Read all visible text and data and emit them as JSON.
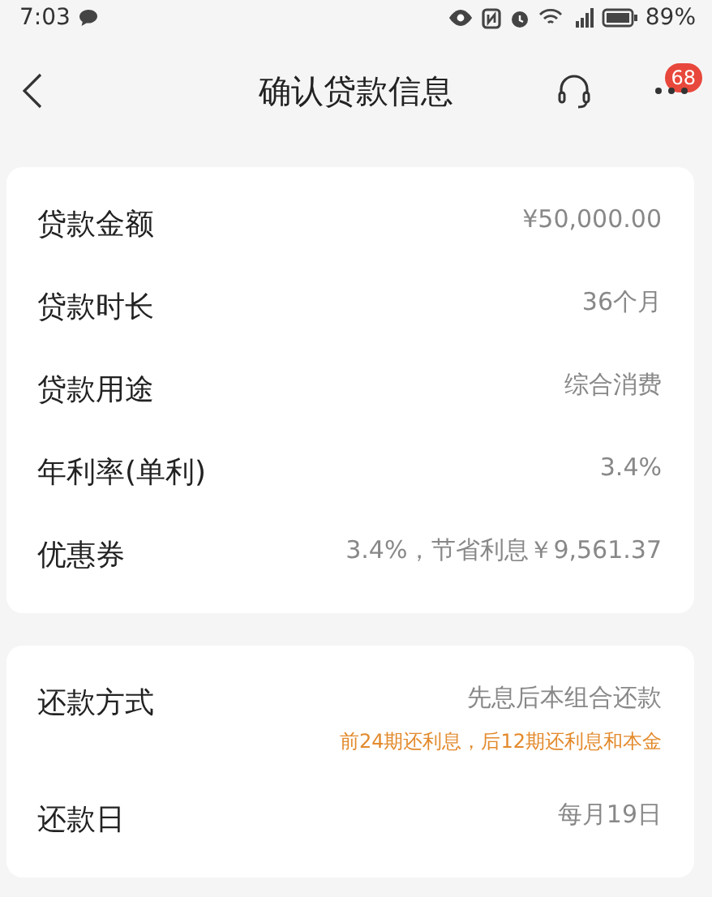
{
  "status_bar": {
    "time": "7:03",
    "battery": "89%"
  },
  "nav": {
    "title": "确认贷款信息",
    "badge": "68"
  },
  "cards": [
    {
      "rows": [
        {
          "label": "贷款金额",
          "value": "¥50,000.00"
        },
        {
          "label": "贷款时长",
          "value": "36个月"
        },
        {
          "label": "贷款用途",
          "value": "综合消费"
        },
        {
          "label": "年利率(单利)",
          "value": "3.4%"
        },
        {
          "label": "优惠券",
          "value": "3.4%，节省利息￥9,561.37"
        }
      ]
    },
    {
      "rows": [
        {
          "label": "还款方式",
          "value": "先息后本组合还款",
          "note": "前24期还利息，后12期还利息和本金"
        },
        {
          "label": "还款日",
          "value": "每月19日"
        }
      ]
    }
  ]
}
